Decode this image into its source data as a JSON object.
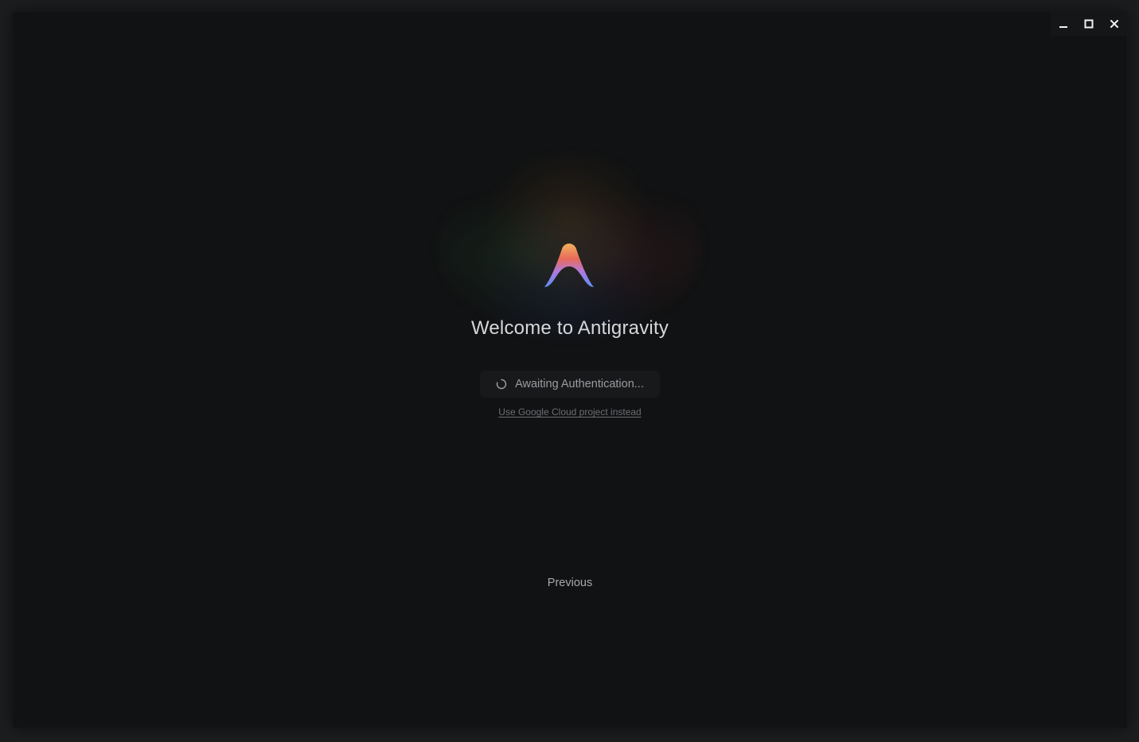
{
  "window": {
    "controls": {
      "minimize_icon": "minimize-icon",
      "maximize_icon": "maximize-icon",
      "close_icon": "close-icon"
    }
  },
  "welcome": {
    "logo_icon": "antigravity-logo",
    "title": "Welcome to Antigravity",
    "auth_status": "Awaiting Authentication...",
    "spinner_icon": "spinner-icon",
    "gcloud_link": "Use Google Cloud project instead",
    "previous_label": "Previous"
  },
  "colors": {
    "background": "#111213",
    "title_text": "#d6d7d9",
    "muted_text": "#9a9ca0",
    "link_text": "#6b6d72",
    "logo_gradient": [
      "#f2b25c",
      "#e86a5a",
      "#b07ae0",
      "#5b8def"
    ]
  }
}
